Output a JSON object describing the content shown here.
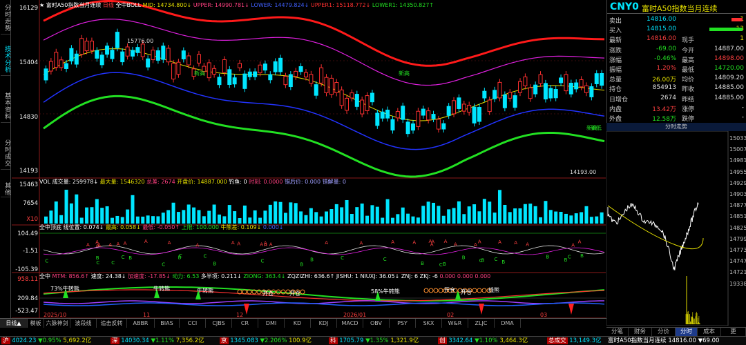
{
  "left_tabs": [
    "分时走势",
    "技术分析",
    "基本资料",
    "分时成交",
    "其他"
  ],
  "main": {
    "title_line": {
      "symbol": "★ 富时A50指数当月连续",
      "period": "日线",
      "indicator": "全中BOLL",
      "mid": "MID: 14734.800↓",
      "upper": "UPPER: 14990.781↓",
      "lower": "LOWER: 14479.824↓",
      "upper1": "UPPER1: 15118.772↓",
      "lower1": "LOWER1: 14350.827↑"
    },
    "price_axis": [
      "16129",
      "15404",
      "14830",
      "14193"
    ],
    "high_label": "15776.00",
    "low_label": "14193.00",
    "volume_line": {
      "name": "VOL 成交量: 259978↓",
      "mavol": "最大量: 1546320",
      "oi": "总差: 2674",
      "settle": "开盘价: 14887.000",
      "delta": "钓鱼: 0",
      "t1": "时刻: 0.0000",
      "t2": "错后价: 0.000",
      "t3": "错解量: 0"
    },
    "volume_axis": [
      "15463",
      "7654"
    ],
    "volume_unit": "X10",
    "ind2_line": {
      "name": "全中顶底",
      "a": "线位置: 0.074↓",
      "b": "最高: 0.058↓",
      "c": "最低: -0.050↑",
      "d": "上限: 100.000",
      "e": "牛熊差: 0.109↓",
      "f": "0.000↓"
    },
    "ind2_axis": [
      "104.49",
      "-1.51",
      "-105.39"
    ],
    "ind3_line": {
      "name": "全中",
      "a": "MTM: 856.6↑",
      "b": "速度: 24.38↓",
      "c": "加速度: -17.85↓",
      "d": "动力: 6.53",
      "e": "多半项: 0.211↓",
      "f": "ZIONG: 363.4↓",
      "g": "ZQZIZHI: 636.6↑",
      "h": "JISHU: 1",
      "i": "NIUXJ: 36.05↓",
      "j": "ZNJ: 6",
      "k": "ZKJ: -6",
      "l": "0.000",
      "m": "0.000",
      "n": "0.000"
    },
    "ind3_axis": [
      "958.11",
      "209.84",
      "-523.47"
    ],
    "ind3_labels": [
      "73%牛转熊",
      "牛转熊",
      "牛转熊",
      "开仓",
      "开仓",
      "58%牛转熊",
      "开仓",
      "开仓",
      "线熊"
    ],
    "date_axis": [
      "2025/10",
      "11",
      "12",
      "2026/01",
      "02",
      "03"
    ],
    "candle_labels": [
      "新高",
      "新高",
      "新高",
      "新低"
    ]
  },
  "quote": {
    "code": "CNY0",
    "name": "富时A50指数当月连续",
    "rows": [
      {
        "l1": "卖出",
        "v1": "14816.00",
        "l2": "",
        "v2": "1"
      },
      {
        "l1": "买入",
        "v1": "14815.00",
        "l2": "",
        "v2": "13"
      },
      {
        "l1": "最新",
        "v1": "14816.00",
        "l2": "现手",
        "v2": "1"
      },
      {
        "l1": "涨跌",
        "v1": "-69.00",
        "l2": "今开",
        "v2": "14887.00"
      },
      {
        "l1": "涨幅",
        "v1": "-0.46%",
        "l2": "最高",
        "v2": "14898.00"
      },
      {
        "l1": "振幅",
        "v1": "1.20%",
        "l2": "最低",
        "v2": "14720.00"
      },
      {
        "l1": "总量",
        "v1": "26.00万",
        "l2": "均价",
        "v2": "14809.20"
      },
      {
        "l1": "持仓",
        "v1": "854913",
        "l2": "昨收",
        "v2": "14885.00"
      },
      {
        "l1": "日增仓",
        "v1": "2674",
        "l2": "昨结",
        "v2": "14885.00"
      },
      {
        "l1": "内盘",
        "v1": "13.42万",
        "l2": "涨停",
        "v2": "-"
      },
      {
        "l1": "外盘",
        "v1": "12.58万",
        "l2": "跌停",
        "v2": "-"
      }
    ]
  },
  "mini": {
    "title": "分时走势",
    "axis": [
      "15033",
      "15007",
      "14981",
      "14955",
      "14929",
      "14903",
      "14877",
      "14851",
      "14825",
      "14799",
      "14773",
      "14747",
      "14721",
      "19338"
    ]
  },
  "right_tabs": [
    "分笔",
    "财务",
    "分价",
    "分时",
    "成本",
    "更"
  ],
  "bottom_tabs": [
    "日线▲",
    "模板",
    "六脉神剑",
    "波段线",
    "追击反转",
    "ABBR",
    "BIAS",
    "CCI",
    "CJBS",
    "CR",
    "DMI",
    "KD",
    "KDJ",
    "MACD",
    "OBV",
    "PSY",
    "SKX",
    "W&R",
    "ZLJC",
    "DMA"
  ],
  "status": [
    {
      "k": "沪",
      "v": "4024.23",
      "c": "▼0.95%",
      "a": "5,692.2亿"
    },
    {
      "k": "深",
      "v": "14030.34",
      "c": "▼1.11%",
      "a": "7,356.2亿"
    },
    {
      "k": "京",
      "v": "1345.083",
      "c": "▼2.206%",
      "a": "100.9亿"
    },
    {
      "k": "科",
      "v": "1705.79",
      "c": "▼1.35%",
      "a": "1,321.9亿"
    },
    {
      "k": "创",
      "v": "3342.64",
      "c": "▼1.10%",
      "a": "3,464.3亿"
    },
    {
      "k": "总成交",
      "v": "13,149.3亿",
      "c": "",
      "a": ""
    }
  ],
  "status_tail": "富时A50指数当月连续 14816.00 ▼69.00",
  "colors": {
    "up": "#ff3030",
    "down": "#00e6ff",
    "upper": "#ff1a1a",
    "upper1": "#e020e0",
    "mid": "#e6e000",
    "lower": "#2233ff",
    "lower1": "#22e022"
  }
}
